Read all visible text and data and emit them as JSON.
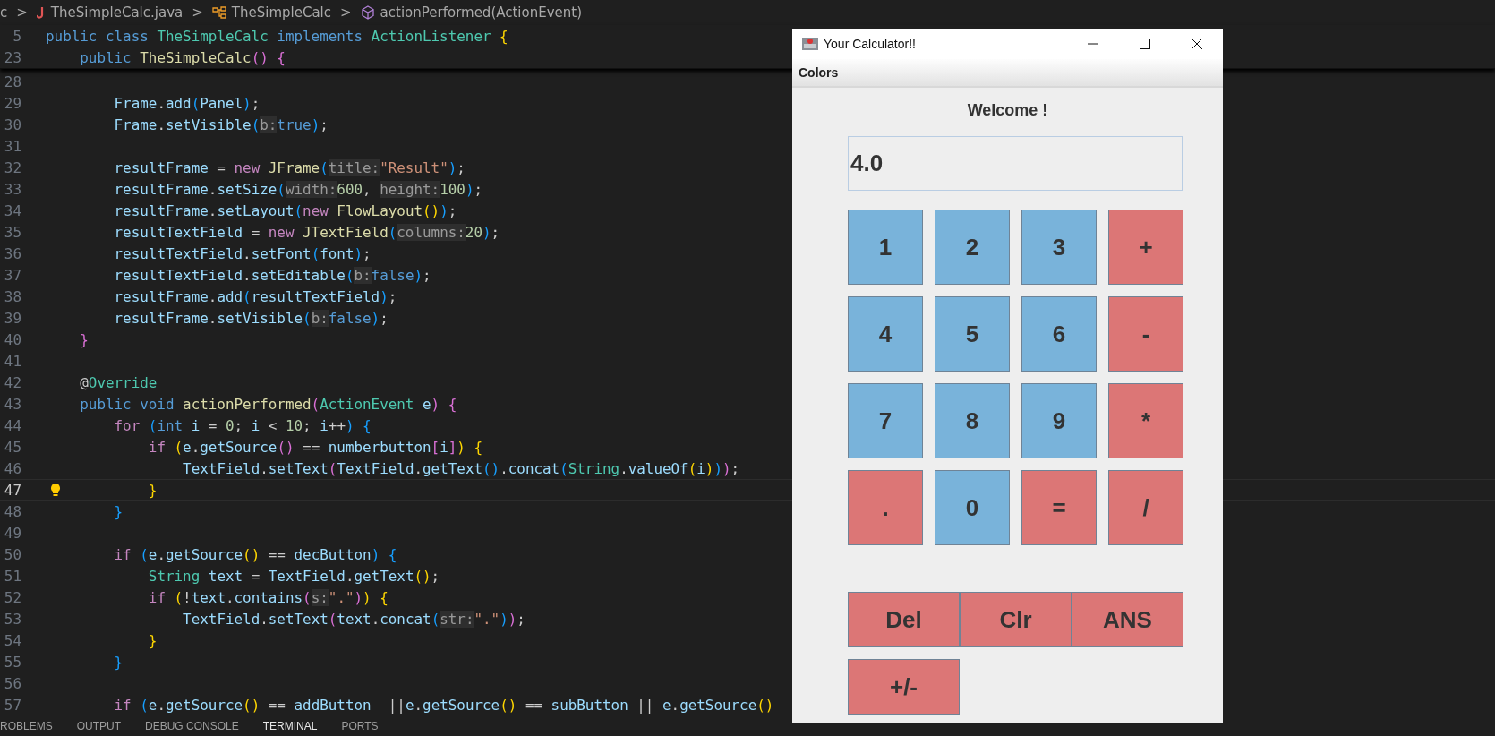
{
  "breadcrumb": {
    "segments": [
      {
        "kind": "folder",
        "label": "c"
      },
      {
        "kind": "file",
        "label": "TheSimpleCalc.java"
      },
      {
        "kind": "class",
        "label": "TheSimpleCalc"
      },
      {
        "kind": "method",
        "label": "actionPerformed(ActionEvent)"
      }
    ],
    "separator": ">"
  },
  "sticky_lines": [
    {
      "num": "5",
      "tokens": [
        {
          "kind": "kw",
          "text": "public class "
        },
        {
          "kind": "type",
          "text": "TheSimpleCalc "
        },
        {
          "kind": "kw",
          "text": "implements "
        },
        {
          "kind": "type",
          "text": "ActionListener "
        },
        {
          "kind": "y",
          "text": "{"
        }
      ]
    },
    {
      "num": "23",
      "tokens": [
        {
          "kind": "kw",
          "text": "    public "
        },
        {
          "kind": "fn",
          "text": "TheSimpleCalc"
        },
        {
          "kind": "m",
          "text": "() {"
        }
      ]
    }
  ],
  "lines": [
    {
      "num": "28",
      "current": false
    },
    {
      "num": "29",
      "current": false,
      "tokens": [
        {
          "kind": "var",
          "text": "        Frame"
        },
        {
          "kind": "pl",
          "text": "."
        },
        {
          "kind": "var",
          "text": "add"
        },
        {
          "kind": "b",
          "text": "("
        },
        {
          "kind": "var",
          "text": "Panel"
        },
        {
          "kind": "b",
          "text": ")"
        },
        {
          "kind": "pl",
          "text": ";"
        }
      ]
    },
    {
      "num": "30",
      "current": false,
      "tokens": [
        {
          "kind": "var",
          "text": "        Frame"
        },
        {
          "kind": "pl",
          "text": "."
        },
        {
          "kind": "var",
          "text": "setVisible"
        },
        {
          "kind": "b",
          "text": "("
        },
        {
          "kind": "hint",
          "text": "b:"
        },
        {
          "kind": "kw",
          "text": "true"
        },
        {
          "kind": "b",
          "text": ")"
        },
        {
          "kind": "pl",
          "text": ";"
        }
      ]
    },
    {
      "num": "31",
      "current": false
    },
    {
      "num": "32",
      "current": false,
      "tokens": [
        {
          "kind": "var",
          "text": "        resultFrame"
        },
        {
          "kind": "pl",
          "text": " = "
        },
        {
          "kind": "ctl",
          "text": "new "
        },
        {
          "kind": "fn",
          "text": "JFrame"
        },
        {
          "kind": "b",
          "text": "("
        },
        {
          "kind": "hint",
          "text": "title:"
        },
        {
          "kind": "str",
          "text": "\"Result\""
        },
        {
          "kind": "b",
          "text": ")"
        },
        {
          "kind": "pl",
          "text": ";"
        }
      ]
    },
    {
      "num": "33",
      "current": false,
      "tokens": [
        {
          "kind": "var",
          "text": "        resultFrame"
        },
        {
          "kind": "pl",
          "text": "."
        },
        {
          "kind": "var",
          "text": "setSize"
        },
        {
          "kind": "b",
          "text": "("
        },
        {
          "kind": "hint",
          "text": "width:"
        },
        {
          "kind": "num",
          "text": "600"
        },
        {
          "kind": "pl",
          "text": ", "
        },
        {
          "kind": "hint",
          "text": "height:"
        },
        {
          "kind": "num",
          "text": "100"
        },
        {
          "kind": "b",
          "text": ")"
        },
        {
          "kind": "pl",
          "text": ";"
        }
      ]
    },
    {
      "num": "34",
      "current": false,
      "tokens": [
        {
          "kind": "var",
          "text": "        resultFrame"
        },
        {
          "kind": "pl",
          "text": "."
        },
        {
          "kind": "var",
          "text": "setLayout"
        },
        {
          "kind": "b",
          "text": "("
        },
        {
          "kind": "ctl",
          "text": "new "
        },
        {
          "kind": "fn",
          "text": "FlowLayout"
        },
        {
          "kind": "y",
          "text": "()"
        },
        {
          "kind": "b",
          "text": ")"
        },
        {
          "kind": "pl",
          "text": ";"
        }
      ]
    },
    {
      "num": "35",
      "current": false,
      "tokens": [
        {
          "kind": "var",
          "text": "        resultTextField"
        },
        {
          "kind": "pl",
          "text": " = "
        },
        {
          "kind": "ctl",
          "text": "new "
        },
        {
          "kind": "fn",
          "text": "JTextField"
        },
        {
          "kind": "b",
          "text": "("
        },
        {
          "kind": "hint",
          "text": "columns:"
        },
        {
          "kind": "num",
          "text": "20"
        },
        {
          "kind": "b",
          "text": ")"
        },
        {
          "kind": "pl",
          "text": ";"
        }
      ]
    },
    {
      "num": "36",
      "current": false,
      "tokens": [
        {
          "kind": "var",
          "text": "        resultTextField"
        },
        {
          "kind": "pl",
          "text": "."
        },
        {
          "kind": "var",
          "text": "setFont"
        },
        {
          "kind": "b",
          "text": "("
        },
        {
          "kind": "var",
          "text": "font"
        },
        {
          "kind": "b",
          "text": ")"
        },
        {
          "kind": "pl",
          "text": ";"
        }
      ]
    },
    {
      "num": "37",
      "current": false,
      "tokens": [
        {
          "kind": "var",
          "text": "        resultTextField"
        },
        {
          "kind": "pl",
          "text": "."
        },
        {
          "kind": "var",
          "text": "setEditable"
        },
        {
          "kind": "b",
          "text": "("
        },
        {
          "kind": "hint",
          "text": "b:"
        },
        {
          "kind": "kw",
          "text": "false"
        },
        {
          "kind": "b",
          "text": ")"
        },
        {
          "kind": "pl",
          "text": ";"
        }
      ]
    },
    {
      "num": "38",
      "current": false,
      "tokens": [
        {
          "kind": "var",
          "text": "        resultFrame"
        },
        {
          "kind": "pl",
          "text": "."
        },
        {
          "kind": "var",
          "text": "add"
        },
        {
          "kind": "b",
          "text": "("
        },
        {
          "kind": "var",
          "text": "resultTextField"
        },
        {
          "kind": "b",
          "text": ")"
        },
        {
          "kind": "pl",
          "text": ";"
        }
      ]
    },
    {
      "num": "39",
      "current": false,
      "tokens": [
        {
          "kind": "var",
          "text": "        resultFrame"
        },
        {
          "kind": "pl",
          "text": "."
        },
        {
          "kind": "var",
          "text": "setVisible"
        },
        {
          "kind": "b",
          "text": "("
        },
        {
          "kind": "hint",
          "text": "b:"
        },
        {
          "kind": "kw",
          "text": "false"
        },
        {
          "kind": "b",
          "text": ")"
        },
        {
          "kind": "pl",
          "text": ";"
        }
      ]
    },
    {
      "num": "40",
      "current": false,
      "tokens": [
        {
          "kind": "m",
          "text": "    }"
        }
      ]
    },
    {
      "num": "41",
      "current": false
    },
    {
      "num": "42",
      "current": false,
      "tokens": [
        {
          "kind": "pl",
          "text": "    @"
        },
        {
          "kind": "type",
          "text": "Override"
        }
      ]
    },
    {
      "num": "43",
      "current": false,
      "tokens": [
        {
          "kind": "kw",
          "text": "    public void "
        },
        {
          "kind": "fn",
          "text": "actionPerformed"
        },
        {
          "kind": "m",
          "text": "("
        },
        {
          "kind": "type",
          "text": "ActionEvent "
        },
        {
          "kind": "var",
          "text": "e"
        },
        {
          "kind": "m",
          "text": ") {"
        }
      ]
    },
    {
      "num": "44",
      "current": false,
      "tokens": [
        {
          "kind": "ctl",
          "text": "        for "
        },
        {
          "kind": "b",
          "text": "("
        },
        {
          "kind": "kw",
          "text": "int "
        },
        {
          "kind": "var",
          "text": "i"
        },
        {
          "kind": "pl",
          "text": " = "
        },
        {
          "kind": "num",
          "text": "0"
        },
        {
          "kind": "pl",
          "text": "; "
        },
        {
          "kind": "var",
          "text": "i"
        },
        {
          "kind": "pl",
          "text": " < "
        },
        {
          "kind": "num",
          "text": "10"
        },
        {
          "kind": "pl",
          "text": "; "
        },
        {
          "kind": "var",
          "text": "i"
        },
        {
          "kind": "pl",
          "text": "++"
        },
        {
          "kind": "b",
          "text": ") {"
        }
      ]
    },
    {
      "num": "45",
      "current": false,
      "tokens": [
        {
          "kind": "ctl",
          "text": "            if "
        },
        {
          "kind": "y",
          "text": "("
        },
        {
          "kind": "var",
          "text": "e"
        },
        {
          "kind": "pl",
          "text": "."
        },
        {
          "kind": "var",
          "text": "getSource"
        },
        {
          "kind": "m",
          "text": "()"
        },
        {
          "kind": "pl",
          "text": " == "
        },
        {
          "kind": "var",
          "text": "numberbutton"
        },
        {
          "kind": "m",
          "text": "["
        },
        {
          "kind": "var",
          "text": "i"
        },
        {
          "kind": "m",
          "text": "]"
        },
        {
          "kind": "y",
          "text": ") {"
        }
      ]
    },
    {
      "num": "46",
      "current": false,
      "tokens": [
        {
          "kind": "var",
          "text": "                TextField"
        },
        {
          "kind": "pl",
          "text": "."
        },
        {
          "kind": "var",
          "text": "setText"
        },
        {
          "kind": "m",
          "text": "("
        },
        {
          "kind": "var",
          "text": "TextField"
        },
        {
          "kind": "pl",
          "text": "."
        },
        {
          "kind": "var",
          "text": "getText"
        },
        {
          "kind": "b",
          "text": "()"
        },
        {
          "kind": "pl",
          "text": "."
        },
        {
          "kind": "var",
          "text": "concat"
        },
        {
          "kind": "b",
          "text": "("
        },
        {
          "kind": "type",
          "text": "String"
        },
        {
          "kind": "pl",
          "text": "."
        },
        {
          "kind": "var",
          "text": "valueOf"
        },
        {
          "kind": "y",
          "text": "("
        },
        {
          "kind": "var",
          "text": "i"
        },
        {
          "kind": "y",
          "text": ")"
        },
        {
          "kind": "b",
          "text": ")"
        },
        {
          "kind": "m",
          "text": ")"
        },
        {
          "kind": "pl",
          "text": ";"
        }
      ]
    },
    {
      "num": "47",
      "current": true,
      "tokens": [
        {
          "kind": "y",
          "text": "            }"
        }
      ]
    },
    {
      "num": "48",
      "current": false,
      "tokens": [
        {
          "kind": "b",
          "text": "        }"
        }
      ]
    },
    {
      "num": "49",
      "current": false
    },
    {
      "num": "50",
      "current": false,
      "tokens": [
        {
          "kind": "ctl",
          "text": "        if "
        },
        {
          "kind": "b",
          "text": "("
        },
        {
          "kind": "var",
          "text": "e"
        },
        {
          "kind": "pl",
          "text": "."
        },
        {
          "kind": "var",
          "text": "getSource"
        },
        {
          "kind": "y",
          "text": "()"
        },
        {
          "kind": "pl",
          "text": " == "
        },
        {
          "kind": "var",
          "text": "decButton"
        },
        {
          "kind": "b",
          "text": ") {"
        }
      ]
    },
    {
      "num": "51",
      "current": false,
      "tokens": [
        {
          "kind": "type",
          "text": "            String "
        },
        {
          "kind": "var",
          "text": "text"
        },
        {
          "kind": "pl",
          "text": " = "
        },
        {
          "kind": "var",
          "text": "TextField"
        },
        {
          "kind": "pl",
          "text": "."
        },
        {
          "kind": "var",
          "text": "getText"
        },
        {
          "kind": "y",
          "text": "()"
        },
        {
          "kind": "pl",
          "text": ";"
        }
      ]
    },
    {
      "num": "52",
      "current": false,
      "tokens": [
        {
          "kind": "ctl",
          "text": "            if "
        },
        {
          "kind": "y",
          "text": "("
        },
        {
          "kind": "pl",
          "text": "!"
        },
        {
          "kind": "var",
          "text": "text"
        },
        {
          "kind": "pl",
          "text": "."
        },
        {
          "kind": "var",
          "text": "contains"
        },
        {
          "kind": "m",
          "text": "("
        },
        {
          "kind": "hint",
          "text": "s:"
        },
        {
          "kind": "str",
          "text": "\".\""
        },
        {
          "kind": "m",
          "text": ")"
        },
        {
          "kind": "y",
          "text": ") {"
        }
      ]
    },
    {
      "num": "53",
      "current": false,
      "tokens": [
        {
          "kind": "var",
          "text": "                TextField"
        },
        {
          "kind": "pl",
          "text": "."
        },
        {
          "kind": "var",
          "text": "setText"
        },
        {
          "kind": "m",
          "text": "("
        },
        {
          "kind": "var",
          "text": "text"
        },
        {
          "kind": "pl",
          "text": "."
        },
        {
          "kind": "var",
          "text": "concat"
        },
        {
          "kind": "b",
          "text": "("
        },
        {
          "kind": "hint",
          "text": "str:"
        },
        {
          "kind": "str",
          "text": "\".\""
        },
        {
          "kind": "b",
          "text": ")"
        },
        {
          "kind": "m",
          "text": ")"
        },
        {
          "kind": "pl",
          "text": ";"
        }
      ]
    },
    {
      "num": "54",
      "current": false,
      "tokens": [
        {
          "kind": "y",
          "text": "            }"
        }
      ]
    },
    {
      "num": "55",
      "current": false,
      "tokens": [
        {
          "kind": "b",
          "text": "        }"
        }
      ]
    },
    {
      "num": "56",
      "current": false
    },
    {
      "num": "57",
      "current": false,
      "tokens": [
        {
          "kind": "ctl",
          "text": "        if "
        },
        {
          "kind": "b",
          "text": "("
        },
        {
          "kind": "var",
          "text": "e"
        },
        {
          "kind": "pl",
          "text": "."
        },
        {
          "kind": "var",
          "text": "getSource"
        },
        {
          "kind": "y",
          "text": "()"
        },
        {
          "kind": "pl",
          "text": " == "
        },
        {
          "kind": "var",
          "text": "addButton"
        },
        {
          "kind": "pl",
          "text": "  ||"
        },
        {
          "kind": "var",
          "text": "e"
        },
        {
          "kind": "pl",
          "text": "."
        },
        {
          "kind": "var",
          "text": "getSource"
        },
        {
          "kind": "y",
          "text": "()"
        },
        {
          "kind": "pl",
          "text": " == "
        },
        {
          "kind": "var",
          "text": "subButton"
        },
        {
          "kind": "pl",
          "text": " || "
        },
        {
          "kind": "var",
          "text": "e"
        },
        {
          "kind": "pl",
          "text": "."
        },
        {
          "kind": "var",
          "text": "getSource"
        },
        {
          "kind": "y",
          "text": "()"
        }
      ]
    }
  ],
  "panel_tabs": [
    {
      "label": "ROBLEMS",
      "selected": false
    },
    {
      "label": "OUTPUT",
      "selected": false
    },
    {
      "label": "DEBUG CONSOLE",
      "selected": false
    },
    {
      "label": "TERMINAL",
      "selected": true
    },
    {
      "label": "PORTS",
      "selected": false
    }
  ],
  "calculator": {
    "window": {
      "title": "Your Calculator!!"
    },
    "menu": [
      "Colors"
    ],
    "heading": "Welcome !",
    "display": "4.0",
    "keys": [
      {
        "label": "1",
        "kind": "digit"
      },
      {
        "label": "2",
        "kind": "digit"
      },
      {
        "label": "3",
        "kind": "digit"
      },
      {
        "label": "+",
        "kind": "operator"
      },
      {
        "label": "4",
        "kind": "digit"
      },
      {
        "label": "5",
        "kind": "digit"
      },
      {
        "label": "6",
        "kind": "digit"
      },
      {
        "label": "-",
        "kind": "operator"
      },
      {
        "label": "7",
        "kind": "digit"
      },
      {
        "label": "8",
        "kind": "digit"
      },
      {
        "label": "9",
        "kind": "digit"
      },
      {
        "label": "*",
        "kind": "operator"
      },
      {
        "label": ".",
        "kind": "operator"
      },
      {
        "label": "0",
        "kind": "digit"
      },
      {
        "label": "=",
        "kind": "operator"
      },
      {
        "label": "/",
        "kind": "operator"
      }
    ],
    "function_keys": [
      {
        "label": "Del"
      },
      {
        "label": "Clr"
      },
      {
        "label": "ANS"
      }
    ],
    "sign_key": {
      "label": "+/-"
    }
  }
}
